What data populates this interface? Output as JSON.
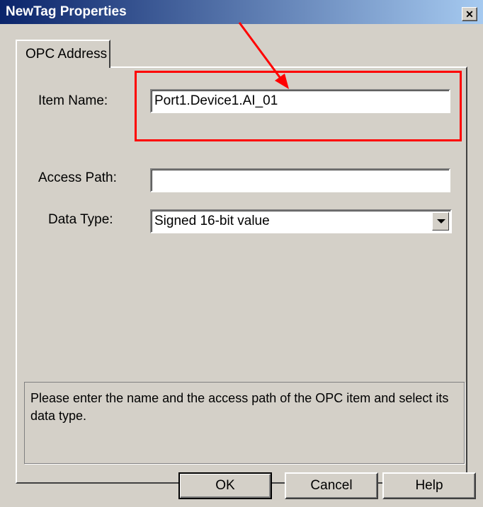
{
  "window": {
    "title": "NewTag Properties",
    "close_glyph": "✕"
  },
  "tabs": [
    {
      "label": "OPC Address",
      "active": true
    }
  ],
  "form": {
    "item_name_label": "Item Name:",
    "item_name_value": "Port1.Device1.AI_01",
    "access_path_label": "Access Path:",
    "access_path_value": "",
    "data_type_label": "Data Type:",
    "data_type_value": "Signed 16-bit value"
  },
  "help": {
    "text": "Please enter the name and the access path of the OPC item and select its data type."
  },
  "buttons": {
    "ok": "OK",
    "cancel": "Cancel",
    "help": "Help"
  },
  "annotation": {
    "highlight_color": "#ff0000",
    "arrow_color": "#ff0000"
  }
}
